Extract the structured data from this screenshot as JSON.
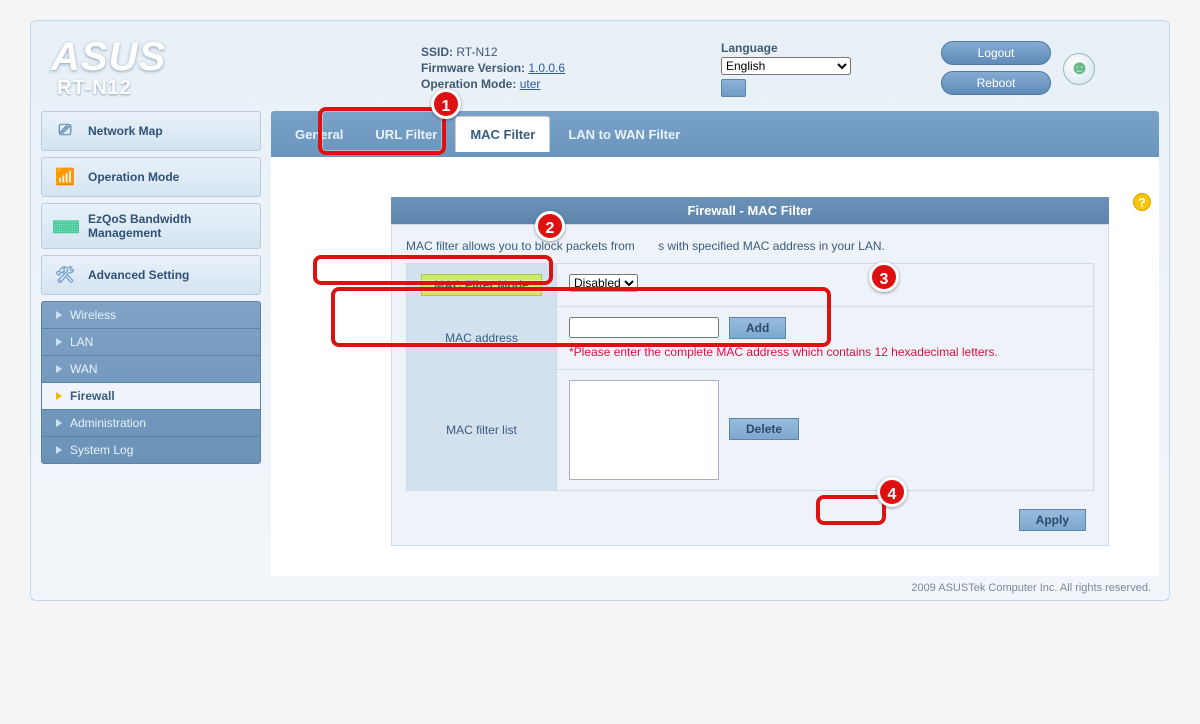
{
  "header": {
    "brand": "ASUS",
    "model": "RT-N12",
    "ssid_label": "SSID:",
    "ssid": "RT-N12",
    "fw_label": "Firmware Version:",
    "fw": "1.0.0.6",
    "mode_label": "Operation Mode:",
    "mode_link_suffix": "uter",
    "lang_label": "Language",
    "lang_value": "English",
    "logout": "Logout",
    "reboot": "Reboot"
  },
  "sidebar": {
    "main": [
      "Network Map",
      "Operation Mode",
      "EzQoS Bandwidth Management",
      "Advanced Setting"
    ],
    "sub": [
      "Wireless",
      "LAN",
      "WAN",
      "Firewall",
      "Administration",
      "System Log"
    ],
    "active_sub": "Firewall"
  },
  "tabs": {
    "items": [
      "General",
      "URL Filter",
      "MAC Filter",
      "LAN to WAN Filter"
    ],
    "active": "MAC Filter"
  },
  "panel": {
    "title": "Firewall - MAC Filter",
    "desc_a": "MAC filter allows you to block packets from",
    "desc_b": "s with specified MAC address in your LAN.",
    "mode_label": "MAC Filter Mode",
    "mode_value": "Disabled",
    "addr_label": "MAC address",
    "addr_warn": "*Please enter the complete MAC address which contains 12 hexadecimal letters.",
    "add_btn": "Add",
    "list_label": "MAC filter list",
    "delete_btn": "Delete",
    "apply_btn": "Apply"
  },
  "callouts": [
    "1",
    "2",
    "3",
    "4"
  ],
  "footer": "2009 ASUSTek Computer Inc. All rights reserved."
}
